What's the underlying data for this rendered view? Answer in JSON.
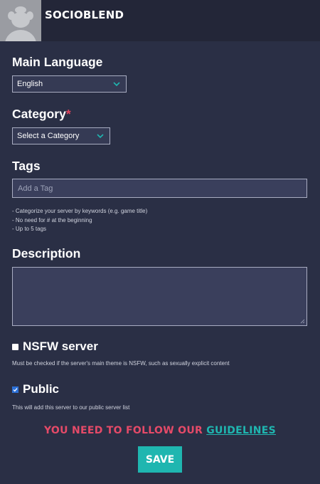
{
  "header": {
    "server_name": "SOCIOBLEND"
  },
  "language": {
    "label": "Main Language",
    "selected": "English"
  },
  "category": {
    "label": "Category",
    "required_mark": "*",
    "selected": "Select a Category"
  },
  "tags": {
    "label": "Tags",
    "placeholder": "Add a Tag",
    "help": [
      "- Categorize your server by keywords (e.g. game title)",
      "- No need for # at the beginning",
      "- Up to 5 tags"
    ]
  },
  "description": {
    "label": "Description",
    "value": ""
  },
  "nsfw": {
    "label": "NSFW server",
    "checked": false,
    "note": "Must be checked if the server's main theme is NSFW, such as sexually explicit content"
  },
  "public": {
    "label": "Public",
    "checked": true,
    "note": "This will add this server to our public server list"
  },
  "guidelines": {
    "prefix": "YOU NEED TO FOLLOW OUR ",
    "link": "GUIDELINES"
  },
  "save": {
    "label": "SAVE"
  },
  "colors": {
    "accent": "#1fb6b0",
    "warning": "#e54a68",
    "background": "#2a2f45"
  }
}
